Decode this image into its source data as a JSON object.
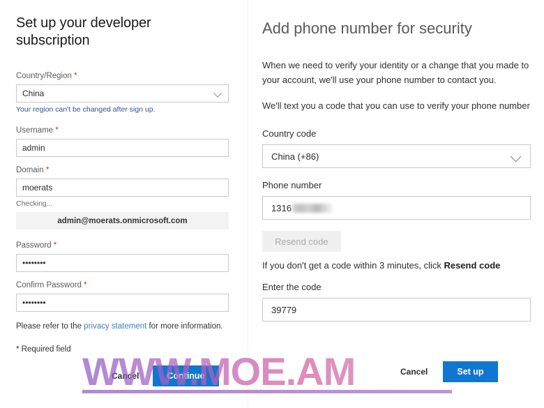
{
  "left": {
    "title": "Set up your developer subscription",
    "country_label": "Country/Region",
    "country_value": "China",
    "country_helper": "Your region can't be changed after sign up.",
    "username_label": "Username",
    "username_value": "admin",
    "domain_label": "Domain",
    "domain_value": "moerats",
    "domain_status": "Checking...",
    "resolved_email": "admin@moerats.onmicrosoft.com",
    "password_label": "Password",
    "password_value": "••••••••",
    "confirm_password_label": "Confirm Password",
    "confirm_password_value": "••••••••",
    "privacy_prefix": "Please refer to the ",
    "privacy_link": "privacy statement",
    "privacy_suffix": " for more information.",
    "required_note": "* Required field",
    "cancel_label": "Cancel",
    "continue_label": "Continue",
    "required_marker": "*"
  },
  "right": {
    "title": "Add phone number for security",
    "paragraph_1": "When we need to verify your identity or a change that you made to your account, we'll use your phone number to contact you.",
    "paragraph_2": "We'll text you a code that you can use to verify your phone number",
    "country_code_label": "Country code",
    "country_code_value": "China (+86)",
    "phone_label": "Phone number",
    "phone_value_visible": "1316",
    "resend_label": "Resend code",
    "resend_note_prefix": "If you don't get a code within 3 minutes, click ",
    "resend_note_bold": "Resend code",
    "enter_code_label": "Enter the code",
    "code_value": "39779",
    "cancel_label": "Cancel",
    "setup_label": "Set up"
  },
  "watermark": {
    "text": "WWW.MOE.AM",
    "gradient_start": "#8e5cc8",
    "gradient_end": "#d6609f"
  },
  "colors": {
    "primary_button": "#0f76d1",
    "link": "#3a7ebf",
    "helper_blue": "#2f5496",
    "required_star": "#c0392b",
    "disabled_button_bg": "#f0f0f0",
    "email_box_bg": "#f3f3f3"
  }
}
